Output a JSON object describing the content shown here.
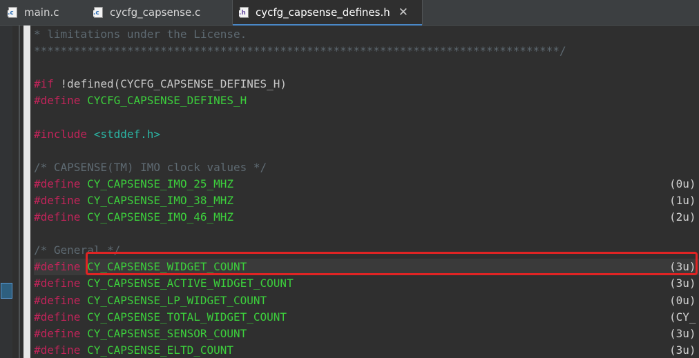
{
  "tabs": [
    {
      "label": "main.c",
      "icon": "c-file-icon",
      "icon_letter": ".c",
      "active": false
    },
    {
      "label": "cycfg_capsense.c",
      "icon": "c-file-icon",
      "icon_letter": ".c",
      "active": false
    },
    {
      "label": "cycfg_capsense_defines.h",
      "icon": "h-file-icon",
      "icon_letter": ".h",
      "active": true,
      "close_glyph": "✕"
    }
  ],
  "editor": {
    "colors": {
      "background": "#2f2f2f",
      "preprocessor": "#c3245a",
      "macro": "#3ccf3c",
      "comment": "#5e6a72",
      "highlight_box": "#e02424"
    },
    "highlighted_line_index": 14,
    "lines": [
      {
        "comment": "* limitations under the License."
      },
      {
        "comment": "*******************************************************************************/"
      },
      {
        "blank": ""
      },
      {
        "pp": "#if",
        "rest": " !defined(CYCFG_CAPSENSE_DEFINES_H)"
      },
      {
        "pp": "#define",
        "macro": "CYCFG_CAPSENSE_DEFINES_H"
      },
      {
        "blank": ""
      },
      {
        "pp": "#include",
        "header": "<stddef.h>"
      },
      {
        "blank": ""
      },
      {
        "comment": "/* CAPSENSE(TM) IMO clock values */"
      },
      {
        "pp": "#define",
        "macro": "CY_CAPSENSE_IMO_25_MHZ",
        "value": "(0u)"
      },
      {
        "pp": "#define",
        "macro": "CY_CAPSENSE_IMO_38_MHZ",
        "value": "(1u)"
      },
      {
        "pp": "#define",
        "macro": "CY_CAPSENSE_IMO_46_MHZ",
        "value": "(2u)"
      },
      {
        "blank": ""
      },
      {
        "comment": "/* General */"
      },
      {
        "pp": "#define",
        "macro": "CY_CAPSENSE_WIDGET_COUNT",
        "value": "(3u)"
      },
      {
        "pp": "#define",
        "macro": "CY_CAPSENSE_ACTIVE_WIDGET_COUNT",
        "value": "(3u)"
      },
      {
        "pp": "#define",
        "macro": "CY_CAPSENSE_LP_WIDGET_COUNT",
        "value": "(0u)"
      },
      {
        "pp": "#define",
        "macro": "CY_CAPSENSE_TOTAL_WIDGET_COUNT",
        "value": "(CY_"
      },
      {
        "pp": "#define",
        "macro": "CY_CAPSENSE_SENSOR_COUNT",
        "value": "(3u)"
      },
      {
        "pp": "#define",
        "macro": "CY_CAPSENSE_ELTD_COUNT",
        "value": "(3u)"
      }
    ]
  }
}
